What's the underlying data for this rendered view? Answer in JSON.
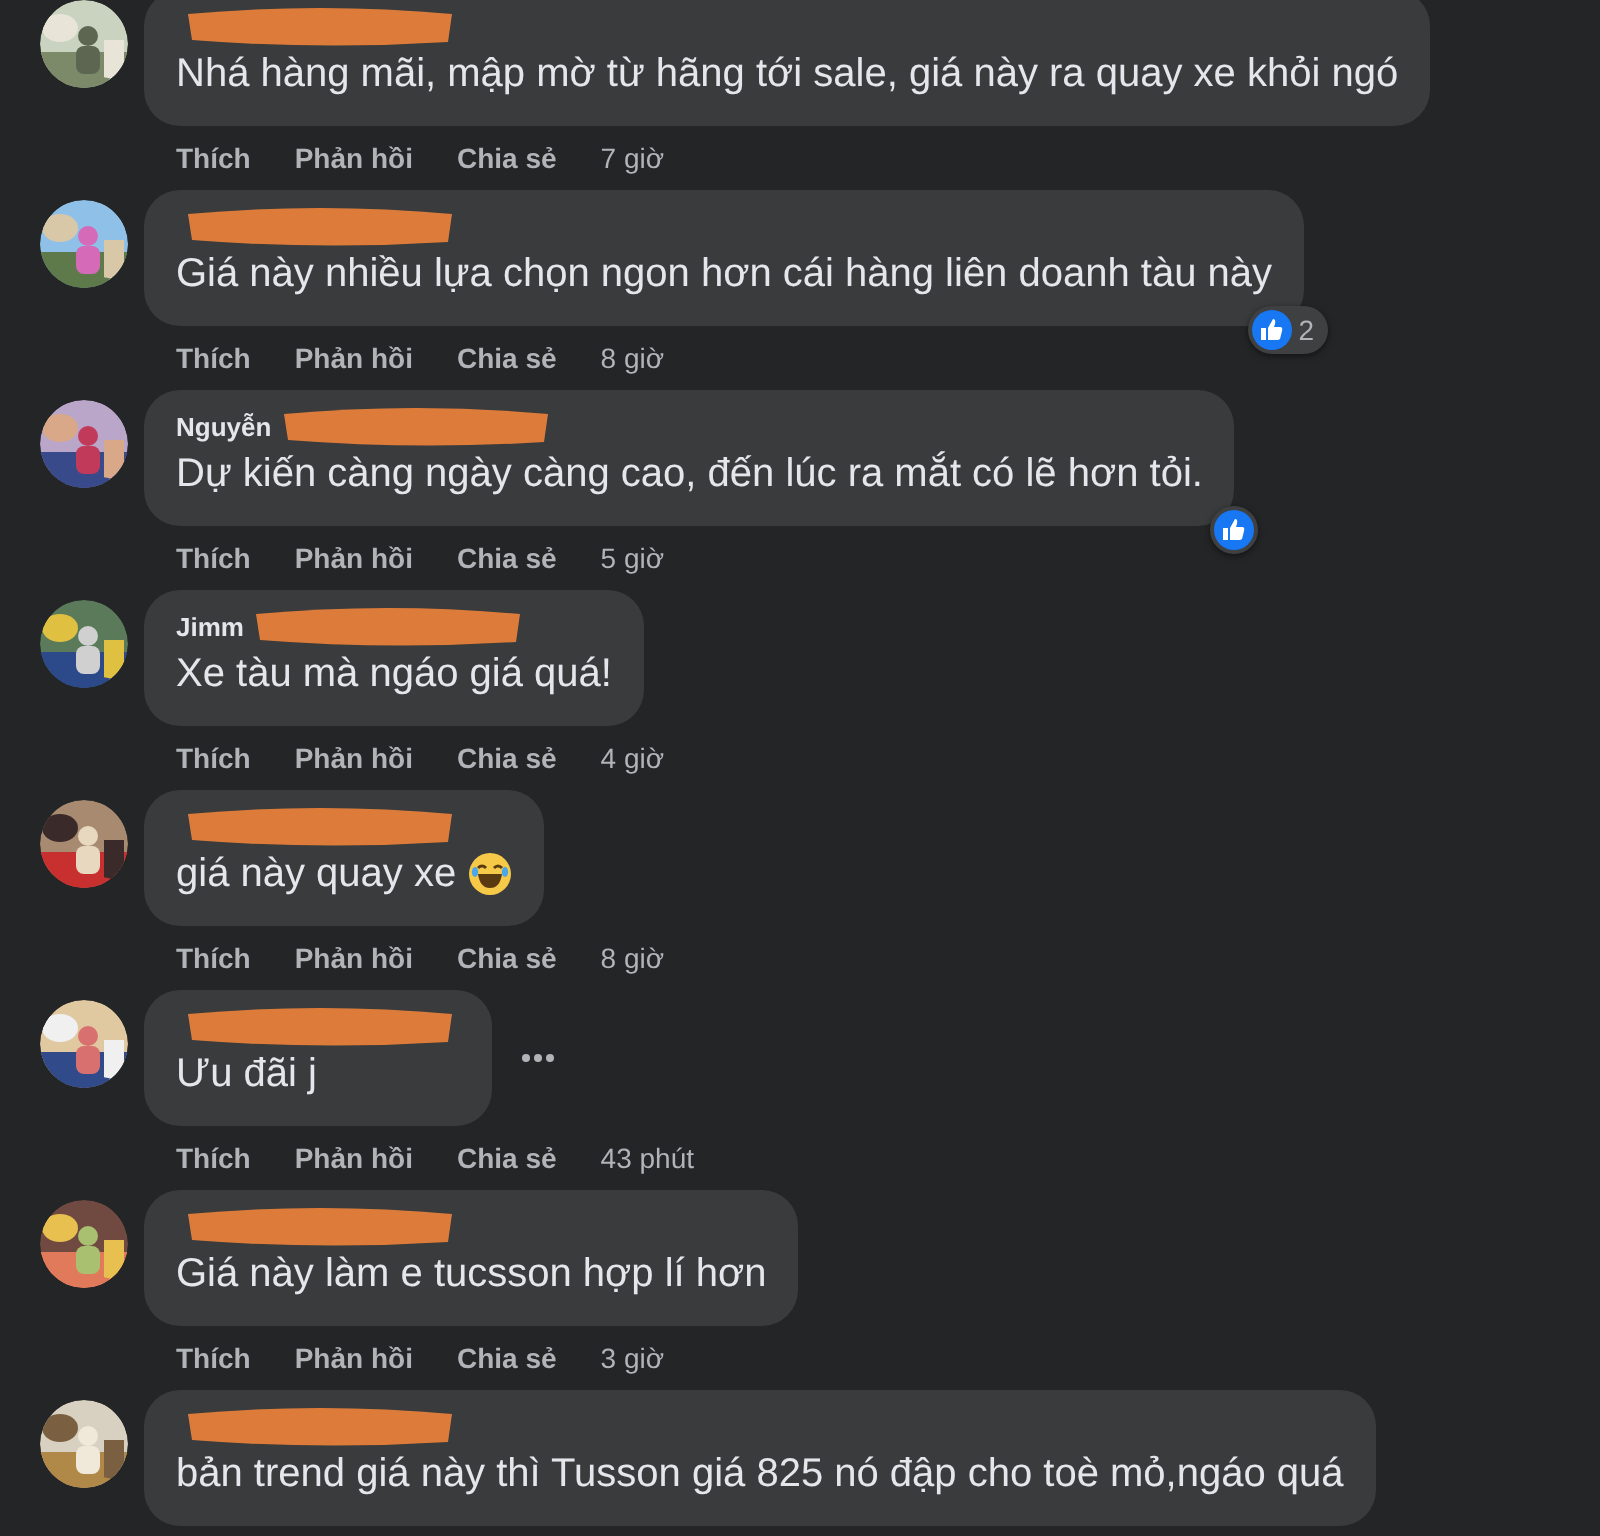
{
  "comments": [
    {
      "name_redacted": true,
      "text": "Nhá hàng mãi, mập mờ từ hãng tới sale, giá này ra quay xe khỏi ngó",
      "actions": [
        "Thích",
        "Phản hồi",
        "Chia sẻ"
      ],
      "time": "7 giờ"
    },
    {
      "name_redacted": true,
      "text": "Giá này nhiều lựa chọn ngon hơn cái hàng liên doanh tàu này",
      "actions": [
        "Thích",
        "Phản hồi",
        "Chia sẻ"
      ],
      "time": "8 giờ",
      "reaction": {
        "kind": "like",
        "count": "2"
      }
    },
    {
      "name": "Nguyễn",
      "name_redacted": true,
      "text": "Dự kiến càng ngày càng cao, đến lúc ra mắt có lẽ hơn tỏi.",
      "actions": [
        "Thích",
        "Phản hồi",
        "Chia sẻ"
      ],
      "time": "5 giờ",
      "reaction": {
        "kind": "like"
      }
    },
    {
      "name": "Jimm",
      "name_redacted": true,
      "text": "Xe tàu mà ngáo giá quá!",
      "actions": [
        "Thích",
        "Phản hồi",
        "Chia sẻ"
      ],
      "time": "4 giờ"
    },
    {
      "name_redacted": true,
      "text": "giá này quay xe",
      "emoji": {
        "kind": "laugh"
      },
      "actions": [
        "Thích",
        "Phản hồi",
        "Chia sẻ"
      ],
      "time": "8 giờ"
    },
    {
      "name_redacted": true,
      "text": "Ưu đãi j",
      "more_options": true,
      "actions": [
        "Thích",
        "Phản hồi",
        "Chia sẻ"
      ],
      "time": "43 phút"
    },
    {
      "name_redacted": true,
      "text": "Giá này làm e tucsson hợp lí hơn",
      "actions": [
        "Thích",
        "Phản hồi",
        "Chia sẻ"
      ],
      "time": "3 giờ"
    },
    {
      "name_redacted": true,
      "text": "bản trend giá này thì Tusson giá 825 nó đập cho toè mỏ,ngáo quá"
    }
  ]
}
